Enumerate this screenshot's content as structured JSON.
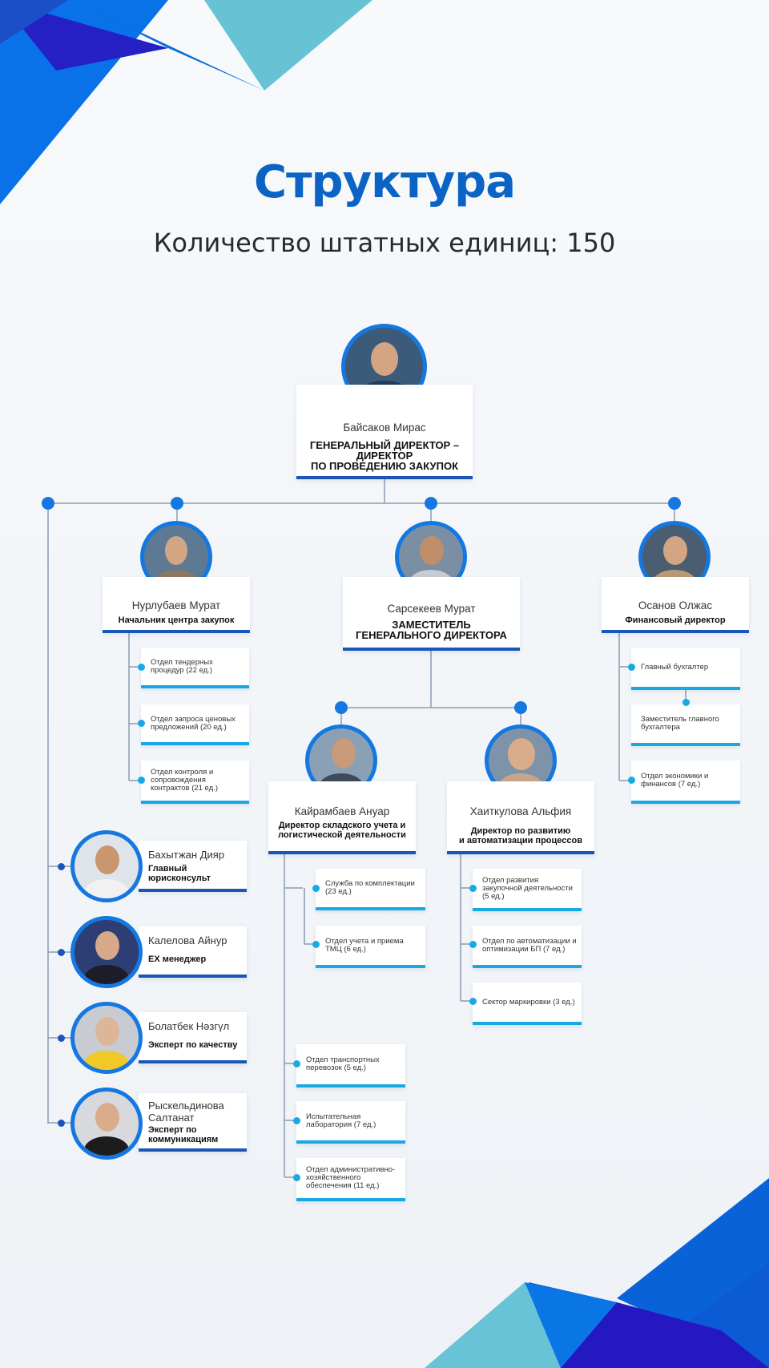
{
  "header": {
    "title": "Структура",
    "subtitle": "Количество штатных единиц:  150"
  },
  "colors": {
    "accent": "#0b63c5",
    "avatar_ring": "#1478e0",
    "dept_underline": "#19a8e6",
    "card_underline": "#1a56b8",
    "connector": "#8a9bb0"
  },
  "head": {
    "name": "Байсаков Мирас",
    "role_line1": "ГЕНЕРАЛЬНЫЙ ДИРЕКТОР –",
    "role_line2": "ДИРЕКТОР",
    "role_line3": "ПО ПРОВЕДЕНИЮ ЗАКУПОК"
  },
  "procurement_center": {
    "name": "Нурлубаев Мурат",
    "role": "Начальник центра закупок",
    "departments": [
      "Отдел тендерных процедур (22 ед.)",
      "Отдел запроса ценовых предложений (20 ед.)",
      "Отдел контроля и сопровождения контрактов (21 ед.)"
    ]
  },
  "deputy": {
    "name": "Сарсекеев Мурат",
    "role_line1": "ЗАМЕСТИТЕЛЬ",
    "role_line2": "ГЕНЕРАЛЬНОГО ДИРЕКТОРА"
  },
  "finance": {
    "name": "Осанов Олжас",
    "role": "Финансовый директор",
    "departments": [
      "Главный бухгалтер",
      "Заместитель главного бухгалтера",
      "Отдел экономики и финансов (7 ед.)"
    ]
  },
  "warehouse": {
    "name": "Кайрамбаев Ануар",
    "role": "Директор складского учета и логистической деятельности",
    "departments_inner": [
      "Служба по комплектации  (23 ед.)",
      "Отдел учета и приема ТМЦ (6 ед.)"
    ],
    "departments_outer": [
      "Отдел транспортных перевозок (5 ед.)",
      "Испытательная лаборатория (7 ед.)",
      "Отдел административно-хозяйственного обеспечения (11 ед.)"
    ]
  },
  "development": {
    "name": "Хаиткулова Альфия",
    "role_line1": "Директор по развитию",
    "role_line2": "и автоматизации процессов",
    "departments": [
      "Отдел развития закупочной деятельности (5 ед.)",
      "Отдел по автоматизации и оптимизации БП (7 ед.)",
      "Сектор маркировки (3 ед.)"
    ]
  },
  "staff": [
    {
      "name": "Бахытжан Дияр",
      "role": "Главный юрисконсульт"
    },
    {
      "name": "Калелова Айнур",
      "role": "EX менеджер"
    },
    {
      "name": "Болатбек Нәзгүл",
      "role": "Эксперт по качеству"
    },
    {
      "name": "Рыскельдинова Салтанат",
      "role": "Эксперт по коммуникациям"
    }
  ]
}
